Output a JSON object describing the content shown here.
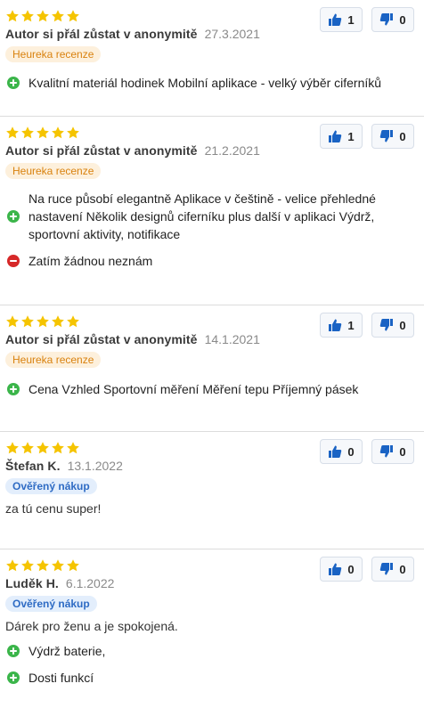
{
  "colors": {
    "star": "#f5c400",
    "pro": "#3bb54a",
    "con": "#d62828",
    "vote_icon": "#1a63c4",
    "heureka_bg": "#fdf0dc",
    "heureka_text": "#d9820f",
    "verified_bg": "#e3eefc",
    "verified_text": "#2e6bc4"
  },
  "icons": {
    "star": "star-icon",
    "like": "thumbs-up-icon",
    "dislike": "thumbs-down-icon",
    "pro": "plus-circle-icon",
    "con": "minus-circle-icon"
  },
  "reviews": [
    {
      "stars": 5,
      "author": "Autor si přál zůstat v anonymitě",
      "date": "27.3.2021",
      "badge": "Heureka recenze",
      "likes": "1",
      "dislikes": "0",
      "pros": [
        "Kvalitní materiál hodinek Mobilní aplikace - velký výběr ciferníků"
      ]
    },
    {
      "stars": 5,
      "author": "Autor si přál zůstat v anonymitě",
      "date": "21.2.2021",
      "badge": "Heureka recenze",
      "likes": "1",
      "dislikes": "0",
      "pros": [
        "Na ruce působí elegantně Aplikace v češtině - velice přehledné nastavení Několik designů ciferníku plus další v aplikaci Výdrž, sportovní aktivity, notifikace"
      ],
      "cons": [
        "Zatím žádnou neznám"
      ]
    },
    {
      "stars": 5,
      "author": "Autor si přál zůstat v anonymitě",
      "date": "14.1.2021",
      "badge": "Heureka recenze",
      "likes": "1",
      "dislikes": "0",
      "pros": [
        "Cena Vzhled Sportovní měření Měření tepu Příjemný pásek"
      ]
    },
    {
      "stars": 5,
      "author": "Štefan K.",
      "date": "13.1.2022",
      "badge": "Ověřený nákup",
      "likes": "0",
      "dislikes": "0",
      "text": "za tú cenu super!"
    },
    {
      "stars": 5,
      "author": "Luděk H.",
      "date": "6.1.2022",
      "badge": "Ověřený nákup",
      "likes": "0",
      "dislikes": "0",
      "text": "Dárek pro ženu a je spokojená.",
      "pros": [
        "Výdrž baterie,",
        "Dosti funkcí"
      ]
    }
  ]
}
